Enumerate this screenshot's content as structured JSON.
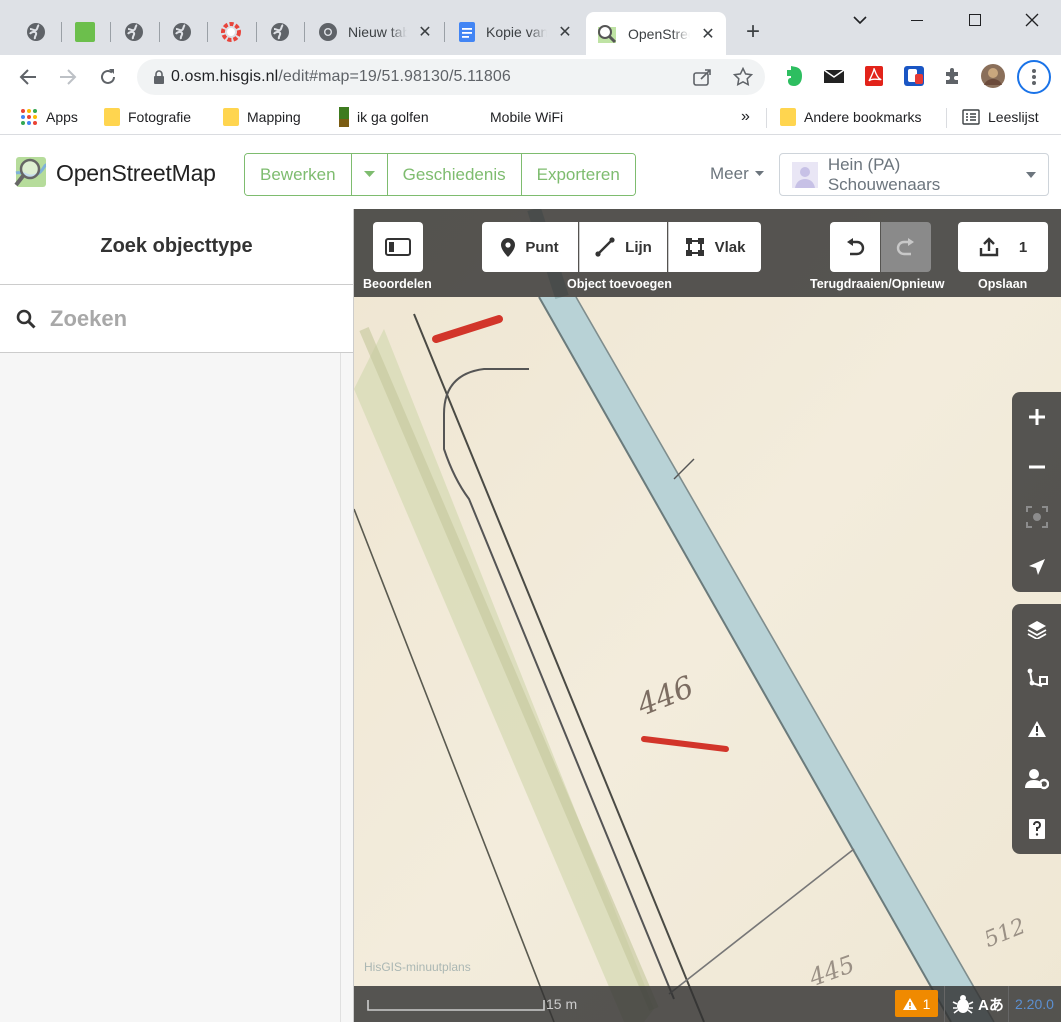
{
  "browser": {
    "tabs": [
      {
        "title": "",
        "icon": "globe-icon"
      },
      {
        "title": "",
        "icon": "green-square-icon"
      },
      {
        "title": "",
        "icon": "globe-icon"
      },
      {
        "title": "",
        "icon": "globe-icon"
      },
      {
        "title": "",
        "icon": "color-ring-icon"
      },
      {
        "title": "",
        "icon": "globe-icon"
      },
      {
        "title": "Nieuw tabblad",
        "icon": "chrome-icon"
      },
      {
        "title": "Kopie van",
        "icon": "docs-icon"
      },
      {
        "title": "OpenStreetMap",
        "icon": "osm-icon",
        "active": true
      }
    ],
    "url_host": "0.osm.hisgis.nl",
    "url_path": "/edit#map=19/51.98130/5.11806",
    "bookmarks": [
      {
        "label": "Apps",
        "icon": "apps-grid-icon"
      },
      {
        "label": "Fotografie",
        "icon": "folder-icon"
      },
      {
        "label": "Mapping",
        "icon": "folder-icon"
      },
      {
        "label": "ik ga golfen",
        "icon": "flag-icon"
      },
      {
        "label": "Mobile WiFi",
        "icon": "none"
      }
    ],
    "bookmarks_overflow": "»",
    "other_bookmarks": "Andere bookmarks",
    "reading_list": "Leeslijst"
  },
  "header": {
    "brand": "OpenStreetMap",
    "edit_label": "Bewerken",
    "history_label": "Geschiedenis",
    "export_label": "Exporteren",
    "more_label": "Meer",
    "user_name": "Hein (PA) Schouwenaars"
  },
  "sidebar": {
    "title": "Zoek objecttype",
    "search_placeholder": "Zoeken"
  },
  "editor": {
    "review_label": "Beoordelen",
    "point_label": "Punt",
    "line_label": "Lijn",
    "area_label": "Vlak",
    "add_object_label": "Object toevoegen",
    "undo_redo_label": "Terugdraaien/Opnieuw",
    "save_count": "1",
    "save_label": "Opslaan",
    "scale_label": "15 m",
    "issues_count": "1",
    "version": "2.20.0",
    "attribution": "HisGIS-minuutplans",
    "map_annotations": [
      "446",
      "445",
      "512"
    ]
  },
  "colors": {
    "osm_green": "#7ebc6f",
    "toolbar_bg": "#323232",
    "issues_orange": "#f08a00",
    "version_blue": "#5b8fd1"
  }
}
